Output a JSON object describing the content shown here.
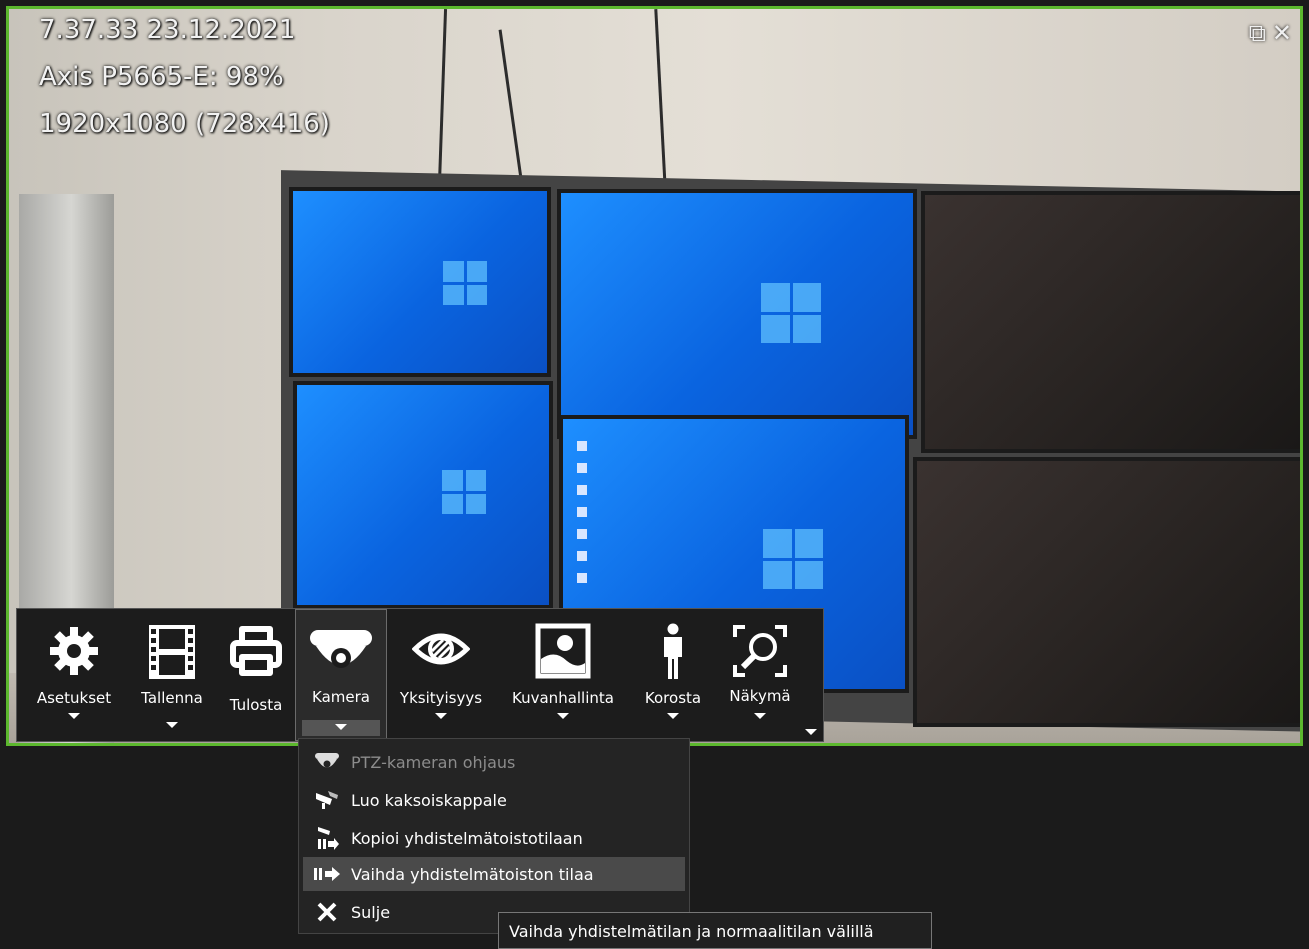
{
  "overlay": {
    "timestamp": "7.37.33  23.12.2021",
    "camera_info": "Axis P5665-E: 98%",
    "resolution": "1920x1080 (728x416)"
  },
  "window_icons": [
    "popout-icon",
    "close-icon"
  ],
  "colors": {
    "selection_border": "#5cb82e",
    "toolbar_bg": "#1c1c1c",
    "menu_bg": "#242424"
  },
  "toolbar": {
    "items": [
      {
        "label": "Asetukset",
        "icon": "gear-icon"
      },
      {
        "label": "Tallenna",
        "icon": "film-icon"
      },
      {
        "label": "Tulosta",
        "icon": "printer-icon"
      },
      {
        "label": "Kamera",
        "icon": "dome-camera-icon"
      },
      {
        "label": "Yksityisyys",
        "icon": "privacy-eye-icon"
      },
      {
        "label": "Kuvanhallinta",
        "icon": "image-control-icon"
      },
      {
        "label": "Korosta",
        "icon": "person-icon"
      },
      {
        "label": "Näkymä",
        "icon": "zoom-view-icon"
      }
    ]
  },
  "camera_menu": {
    "items": [
      {
        "label": "PTZ-kameran ohjaus",
        "icon": "ptz-camera-icon",
        "enabled": false
      },
      {
        "label": "Luo kaksoiskappale",
        "icon": "duplicate-camera-icon",
        "enabled": true
      },
      {
        "label": "Kopioi yhdistelmätoistotilaan",
        "icon": "copy-to-composite-icon",
        "enabled": true
      },
      {
        "label": "Vaihda yhdistelmätoiston tilaa",
        "icon": "switch-composite-icon",
        "enabled": true,
        "highlighted": true
      },
      {
        "label": "Sulje",
        "icon": "close-icon",
        "enabled": true
      }
    ]
  },
  "tooltip": {
    "text": "Vaihda yhdistelmätilan ja normaalitilan välillä"
  }
}
